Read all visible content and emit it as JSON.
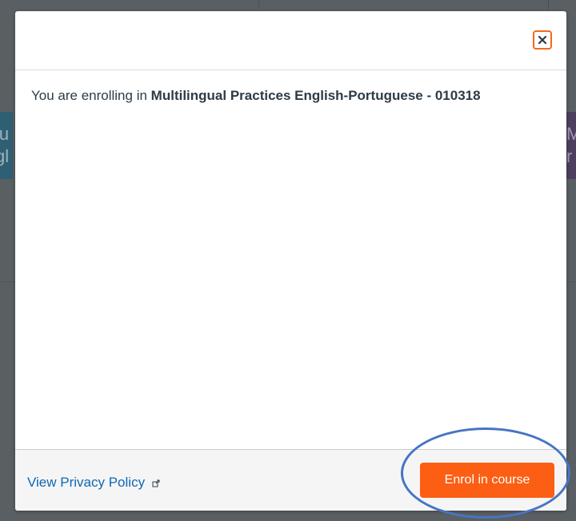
{
  "background": {
    "left_card_text": "lu\ngl",
    "right_card_text": "M\nr"
  },
  "dialog": {
    "close_label": "Close",
    "enroll_prefix": "You are enrolling in",
    "course_name": "Multilingual Practices English-Portuguese - 010318",
    "privacy_link": "View Privacy Policy",
    "enrol_button": "Enrol in course"
  },
  "annotation": {
    "highlight_color": "#4874c4",
    "highlight_target": "enrol-course-button"
  },
  "colors": {
    "accent": "#fc5e13",
    "close_border": "#f26b1d",
    "link": "#0e68b3",
    "text": "#2d3b45",
    "backdrop": "#5a5f63"
  },
  "icons": {
    "close": "close-icon",
    "external_link": "external-link-icon"
  }
}
